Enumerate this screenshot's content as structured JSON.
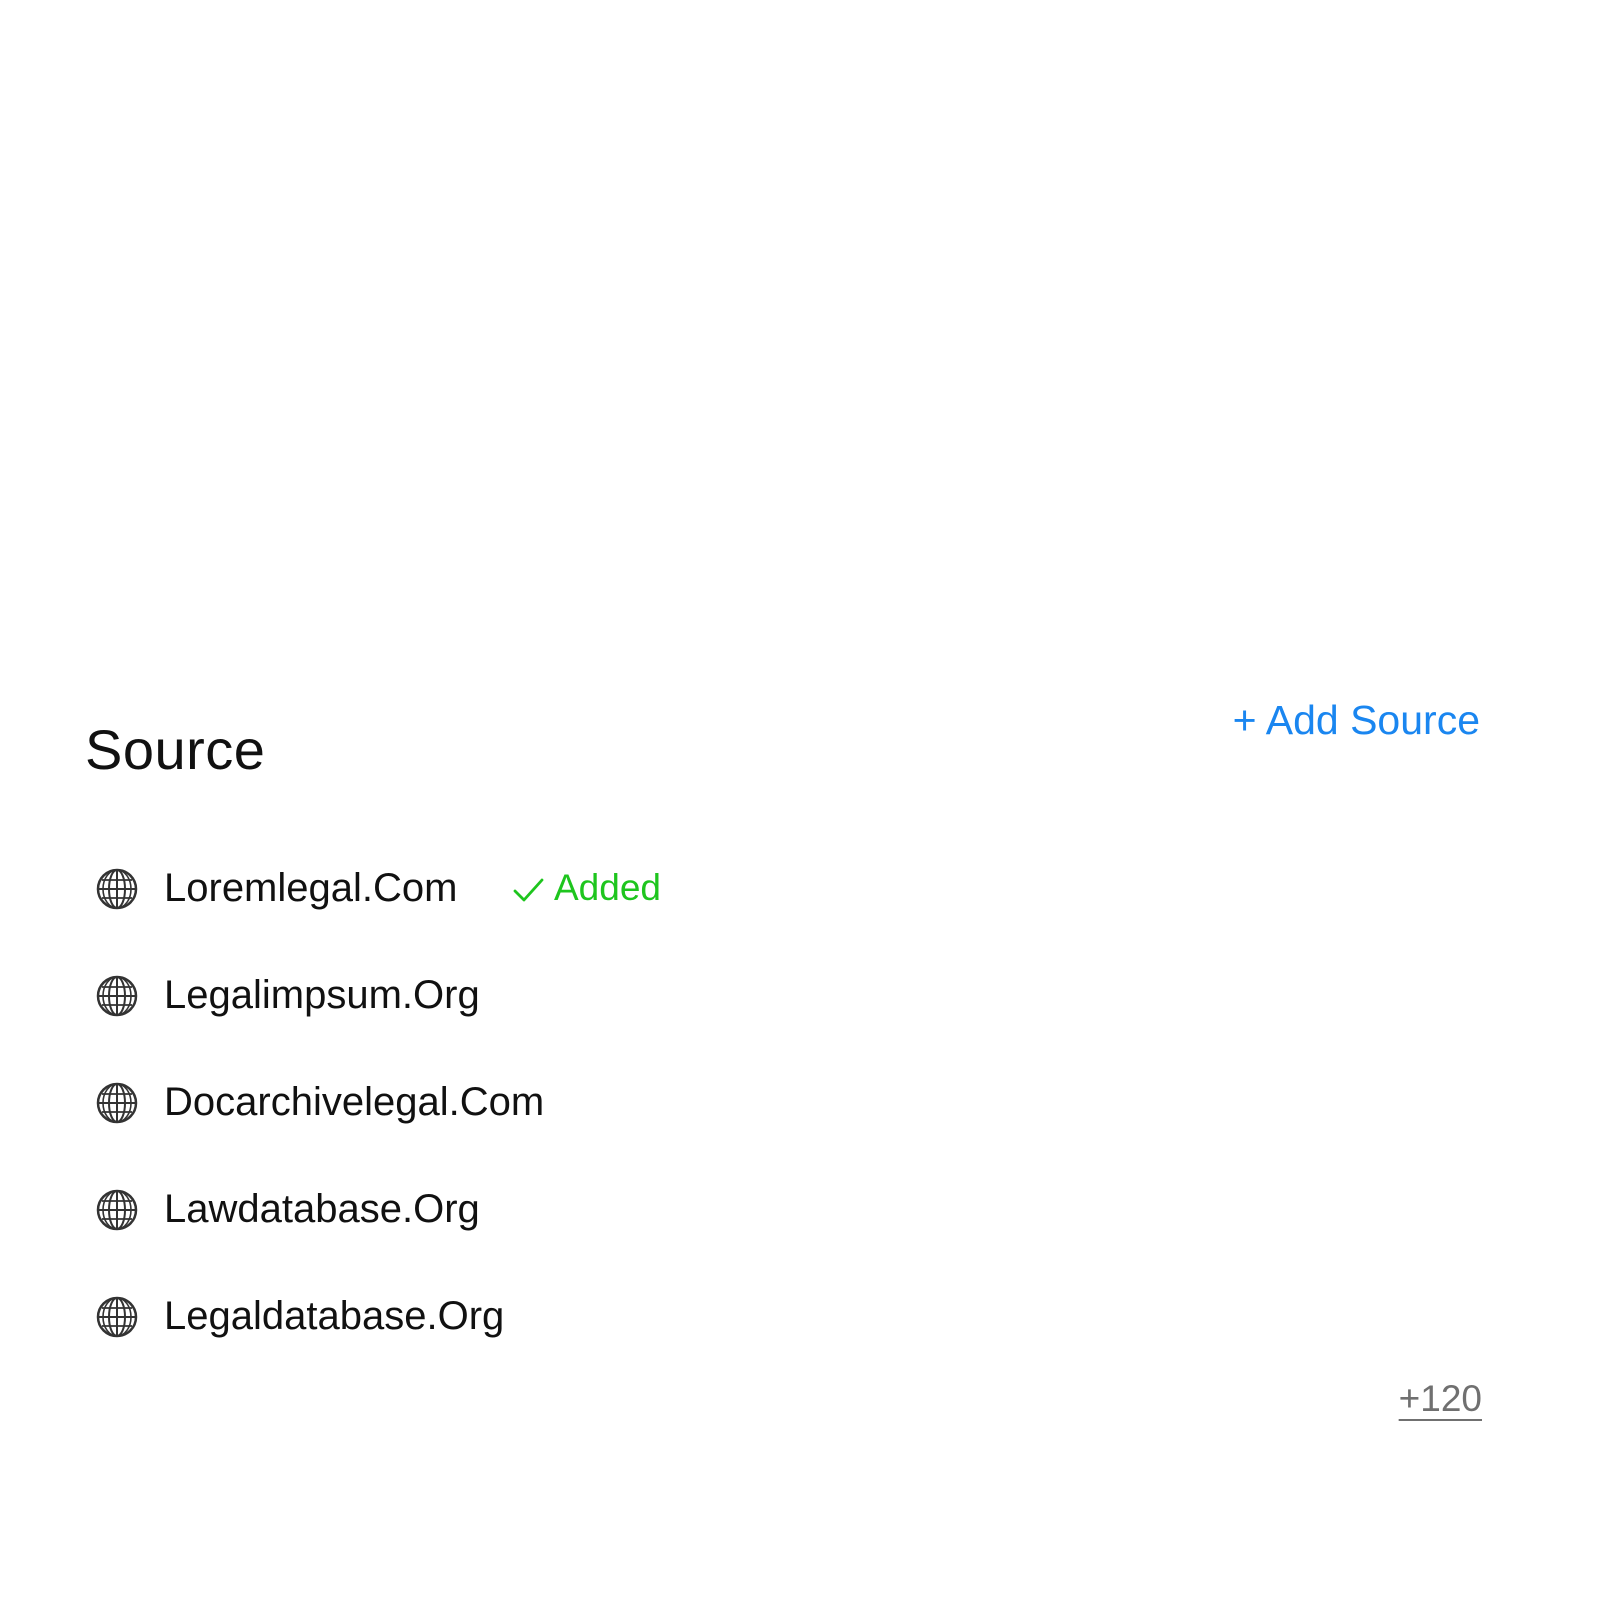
{
  "section": {
    "title": "Source",
    "add_source_label": "+ Add Source"
  },
  "sources": [
    {
      "name": "Loremlegal.Com",
      "status": "Added",
      "icon": "globe-icon"
    },
    {
      "name": "Legalimpsum.Org",
      "icon": "globe-icon"
    },
    {
      "name": "Docarchivelegal.Com",
      "icon": "globe-icon"
    },
    {
      "name": "Lawdatabase.Org",
      "icon": "globe-icon"
    },
    {
      "name": "Legaldatabase.Org",
      "icon": "globe-icon"
    }
  ],
  "more_count": "+120",
  "colors": {
    "accent": "#1a86f0",
    "success": "#1ec51e",
    "muted": "#707070",
    "text": "#111111"
  }
}
